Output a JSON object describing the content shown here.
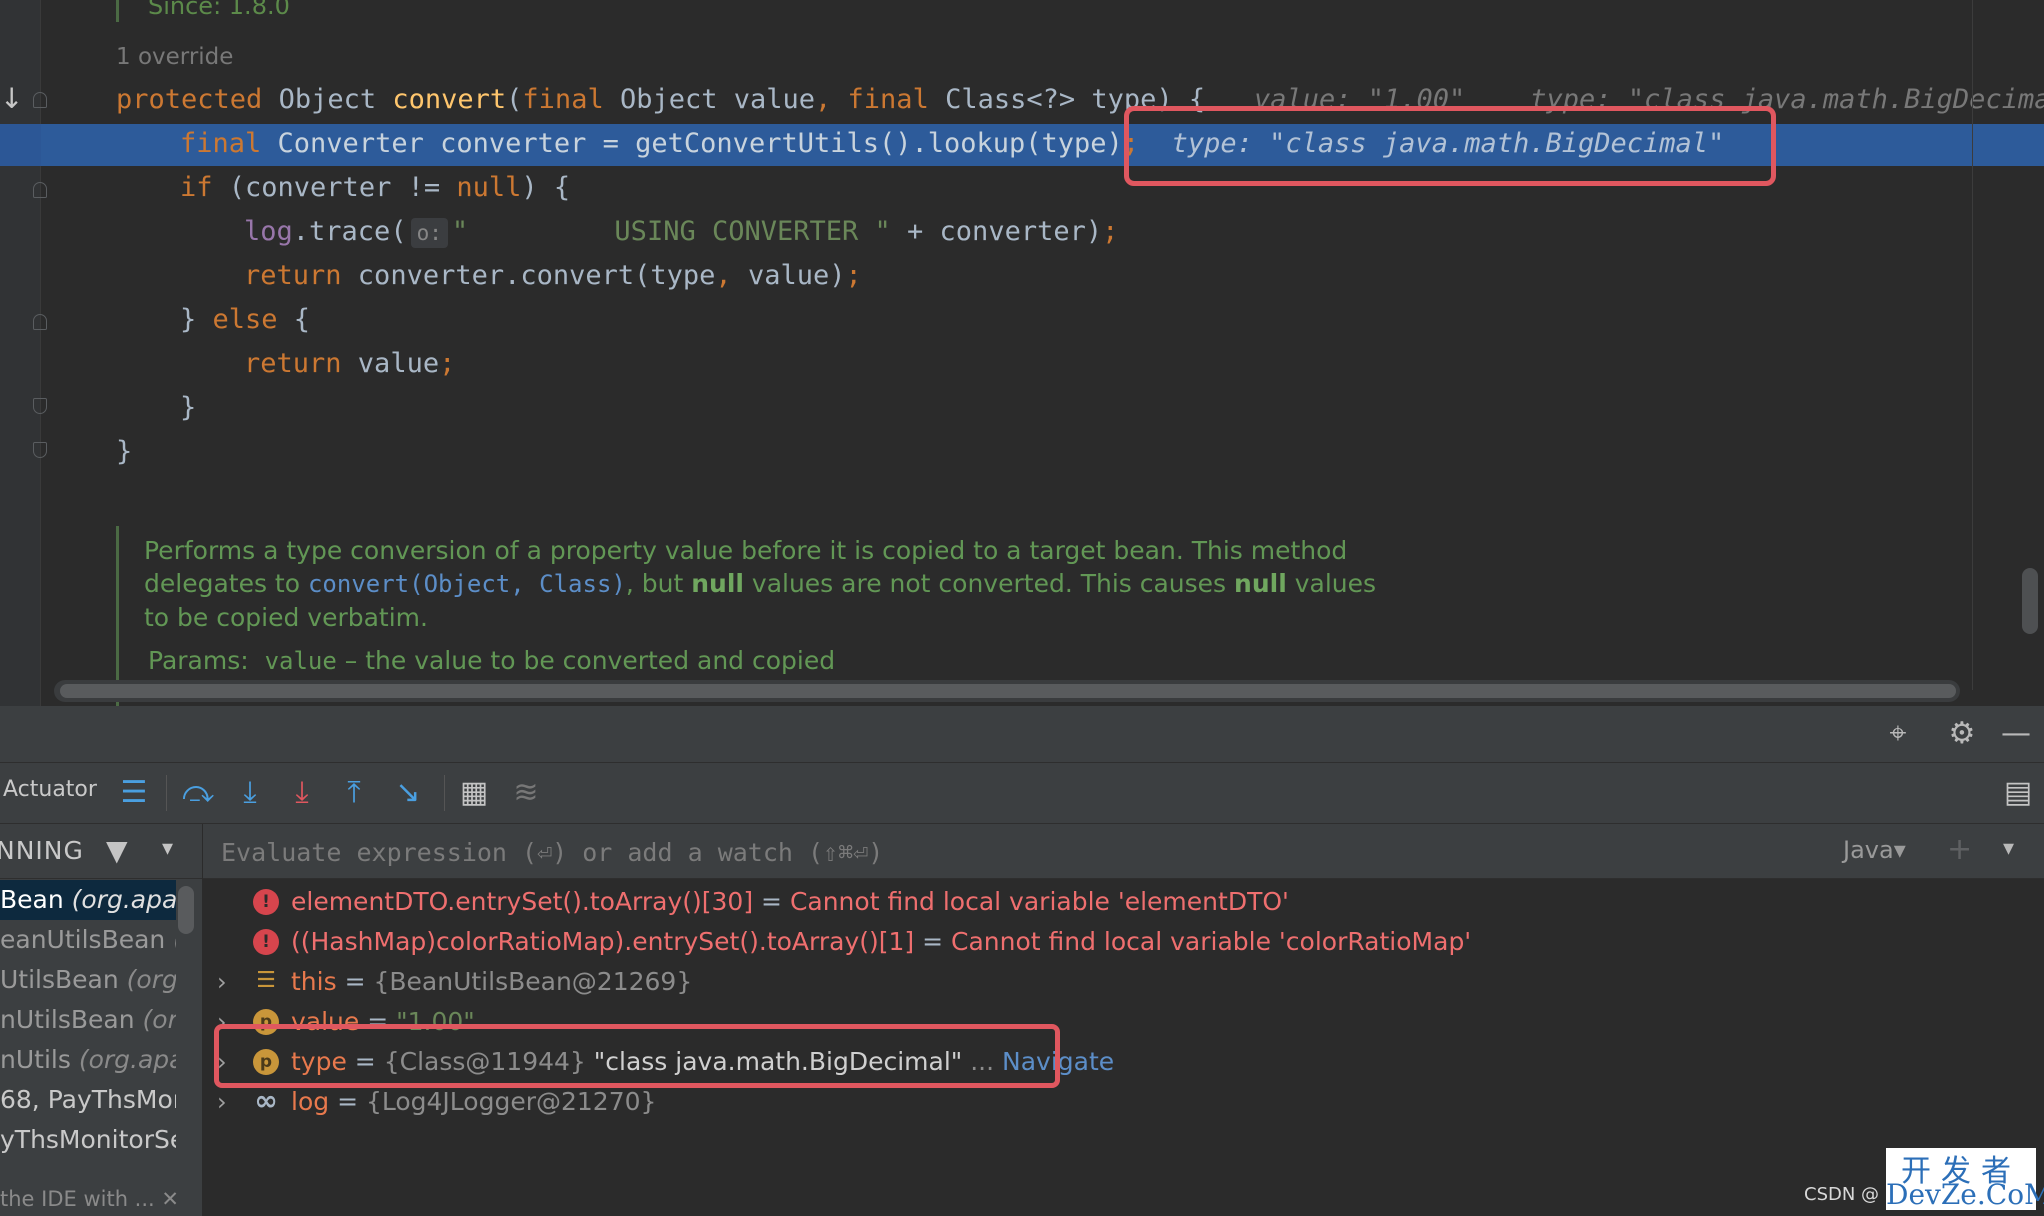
{
  "editor": {
    "since_line": "Since:    1.8.0",
    "override_hint": "1 override",
    "lines": {
      "l1": {
        "kw1": "protected",
        "t1": " Object ",
        "fn": "convert",
        "t2": "(",
        "kw2": "final",
        "t3": " Object value",
        "kw3": ", final",
        "t4": " Class<?> type) {",
        "hint1": "   value: \"1.00\"",
        "hint2": "    type: \"class java.math.BigDecimal\""
      },
      "l2": {
        "kw1": "final",
        "t1": " Converter converter = getConvertUtils().lookup(type)",
        "semi": ";",
        "hint": "  type: \"class java.math.BigDecimal\""
      },
      "l3": {
        "kw1": "if",
        "t1": " (converter != ",
        "kw2": "null",
        "t2": ") {"
      },
      "l4": {
        "field": "log",
        "t1": ".trace(",
        "chip": "o:",
        "str": "\"         USING CONVERTER \"",
        "t2": " + converter)",
        "semi": ";"
      },
      "l5": {
        "kw1": "return",
        "t1": " converter.convert(type",
        "kw2": ",",
        "t2": " value)",
        "semi": ";"
      },
      "l6": {
        "t1": "} ",
        "kw1": "else",
        "t2": " {"
      },
      "l7": {
        "kw1": "return",
        "t1": " value",
        "semi": ";"
      },
      "l8": {
        "t1": "}"
      },
      "l9": {
        "t1": "}"
      }
    },
    "doc": {
      "p1": "Performs a type conversion of a property value before it is copied to a target bean. This method delegates to ",
      "ref": "convert(Object, Class)",
      "p2": ", but ",
      "b1": "null",
      "p3": " values are not converted. This causes ",
      "b2": "null",
      "p4": " values to be copied verbatim.",
      "params_label": "Params:",
      "param_name": "value",
      "param_desc": " – the value to be converted and copied"
    }
  },
  "debug": {
    "tab_label": "Actuator",
    "running_label": "NNING",
    "eval_placeholder": "Evaluate expression (⏎) or add a watch (⇧⌘⏎)",
    "language": "Java",
    "frames": [
      {
        "name": "Bean ",
        "pkg": "(org.apac"
      },
      {
        "name": "eanUtilsBean ",
        "pkg": "("
      },
      {
        "name": "UtilsBean ",
        "pkg": "(org."
      },
      {
        "name": "nUtilsBean ",
        "pkg": "(or"
      },
      {
        "name": "nUtils ",
        "pkg": "(org.apa"
      },
      {
        "name": "68, PayThsMor",
        "pkg": ""
      },
      {
        "name": "yThsMonitorSe",
        "pkg": ""
      }
    ],
    "frames_footer": "the IDE with ... ✕",
    "variables": [
      {
        "name": "elementDTO.entrySet().toArray()[30]",
        "eq": " = ",
        "value": "Cannot find local variable 'elementDTO'"
      },
      {
        "name": "((HashMap)colorRatioMap).entrySet().toArray()[1]",
        "eq": " = ",
        "value": "Cannot find local variable 'colorRatioMap'"
      },
      {
        "name": "this",
        "eq": " = ",
        "ref": "{BeanUtilsBean@21269}"
      },
      {
        "name": "value",
        "eq": " = ",
        "value": "\"1.00\""
      },
      {
        "name": "type",
        "eq": " = ",
        "ref": "{Class@11944} ",
        "value": "\"class java.math.BigDecimal\"",
        "more": " ... ",
        "nav": "Navigate"
      },
      {
        "name": "log",
        "eq": " = ",
        "ref": "{Log4JLogger@21270}"
      }
    ]
  },
  "watermark": {
    "top": "开发者",
    "bottom": "DevZe.CoM",
    "credit": "CSDN @"
  },
  "colors": {
    "highlight": "#2d5b9a",
    "callout": "#e0575f",
    "keyword": "#cc7832",
    "string": "#6a8759"
  }
}
